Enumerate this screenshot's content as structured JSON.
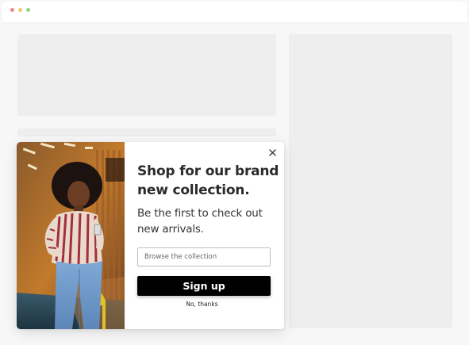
{
  "window": {
    "controls": [
      {
        "name": "close",
        "color": "#f28b82"
      },
      {
        "name": "minimize",
        "color": "#f5c66b"
      },
      {
        "name": "maximize",
        "color": "#8fd18a"
      }
    ]
  },
  "popup": {
    "image": "woman-holding-phone-photo",
    "close_icon": "close-icon",
    "headline": "Shop for our brand new collection.",
    "subtext": "Be the first to check out new arrivals.",
    "input_placeholder": "Browse the collection",
    "input_value": "",
    "signup_label": "Sign up",
    "decline_label": "No, thanks"
  },
  "colors": {
    "page_bg": "#f7f7f7",
    "placeholder": "#eeeeee",
    "button_bg": "#000000",
    "button_text": "#ffffff",
    "headline_text": "#2b2b2b"
  }
}
